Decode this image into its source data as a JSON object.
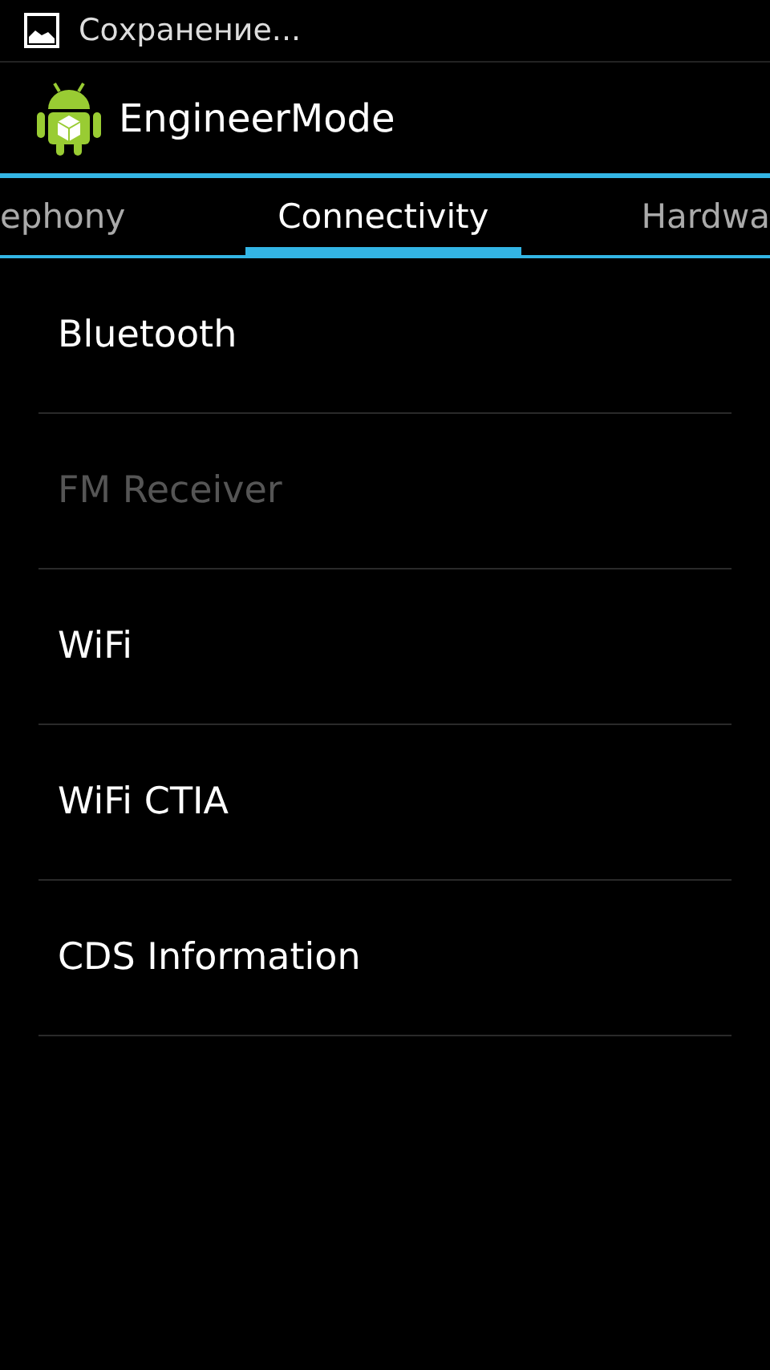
{
  "status_bar": {
    "notification": "Сохранение..."
  },
  "action_bar": {
    "title": "EngineerMode"
  },
  "tabs": [
    {
      "label": "ephony",
      "selected": false
    },
    {
      "label": "Connectivity",
      "selected": true
    },
    {
      "label": "Hardwa",
      "selected": false
    }
  ],
  "items": [
    {
      "label": "Bluetooth",
      "disabled": false
    },
    {
      "label": "FM Receiver",
      "disabled": true
    },
    {
      "label": "WiFi",
      "disabled": false
    },
    {
      "label": "WiFi CTIA",
      "disabled": false
    },
    {
      "label": "CDS Information",
      "disabled": false
    }
  ]
}
